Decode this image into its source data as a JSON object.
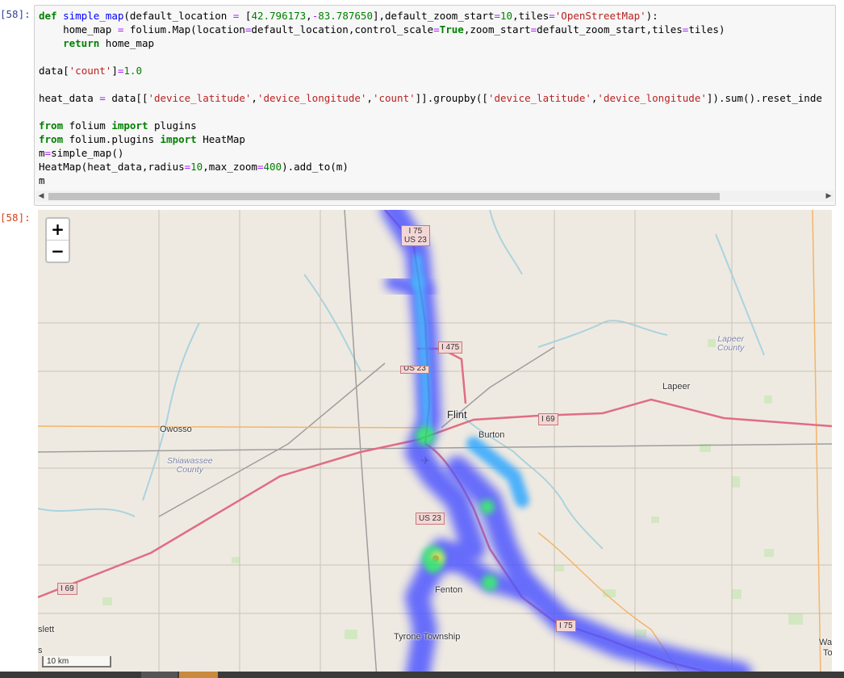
{
  "cells": {
    "input_prompt": "[58]:",
    "output_prompt": "[58]:"
  },
  "code_lines": [
    "def simple_map(default_location = [42.796173,-83.787650],default_zoom_start=10,tiles='OpenStreetMap'):",
    "    home_map = folium.Map(location=default_location,control_scale=True,zoom_start=default_zoom_start,tiles=tiles)",
    "    return home_map",
    "",
    "data['count']=1.0",
    "",
    "heat_data = data[['device_latitude','device_longitude','count']].groupby(['device_latitude','device_longitude']).sum().reset_inde",
    "",
    "from folium import plugins",
    "from folium.plugins import HeatMap",
    "m=simple_map()",
    "HeatMap(heat_data,radius=10,max_zoom=400).add_to(m)",
    "m"
  ],
  "map": {
    "zoom_in": "+",
    "zoom_out": "−",
    "scale_label": "10 km",
    "places": {
      "flint": "Flint",
      "burton": "Burton",
      "owosso": "Owosso",
      "lapeer": "Lapeer",
      "fenton": "Fenton",
      "tyrone": "Tyrone Township",
      "slett": "slett",
      "s": "s",
      "wa": "Wa",
      "to": "To",
      "shiawassee_1": "Shiawassee",
      "shiawassee_2": "County",
      "lapeer_county_1": "Lapeer",
      "lapeer_county_2": "County"
    },
    "shields": {
      "i75_us23_a": "I 75",
      "i75_us23_b": "US 23",
      "i475": "I 475",
      "us23_partial": "US 23",
      "i69_east": "I 69",
      "us23_south": "US 23",
      "i69_west": "I 69",
      "i75_south": "I 75"
    },
    "icons": {
      "airport": "airplane-icon"
    },
    "colors": {
      "land": "#efeae1",
      "motorway": "#e06d85",
      "water": "#aad3df",
      "heat_low": "#0000ff",
      "heat_mid": "#00ff00",
      "heat_high": "#ffff00"
    }
  }
}
